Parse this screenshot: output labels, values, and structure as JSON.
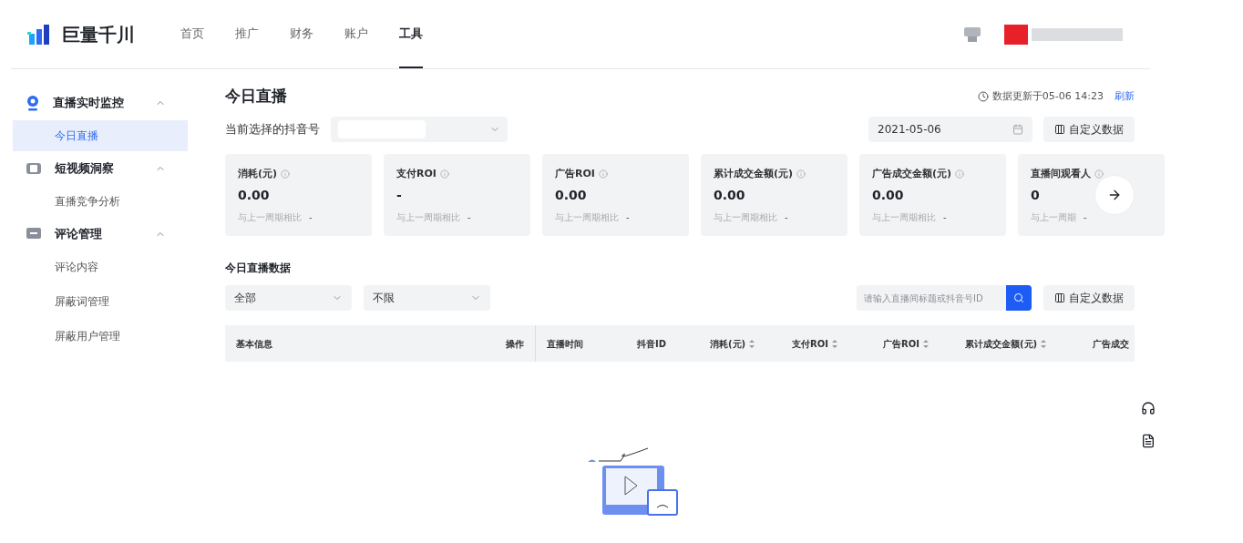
{
  "brand": "巨量千川",
  "nav": [
    {
      "label": "首页",
      "selected": false
    },
    {
      "label": "推广",
      "selected": false
    },
    {
      "label": "财务",
      "selected": false
    },
    {
      "label": "账户",
      "selected": false
    },
    {
      "label": "工具",
      "selected": true
    }
  ],
  "sidebar": [
    {
      "label": "直播实时监控",
      "kind": "live",
      "expanded": true,
      "children": [
        {
          "label": "今日直播",
          "selected": true
        }
      ]
    },
    {
      "label": "短视频洞察",
      "kind": "video",
      "expanded": true,
      "children": [
        {
          "label": "直播竞争分析",
          "selected": false
        }
      ]
    },
    {
      "label": "评论管理",
      "kind": "comment",
      "expanded": true,
      "children": [
        {
          "label": "评论内容",
          "selected": false
        },
        {
          "label": "屏蔽词管理",
          "selected": false
        },
        {
          "label": "屏蔽用户管理",
          "selected": false
        }
      ]
    }
  ],
  "page_title": "今日直播",
  "update_time": "数据更新于05-06 14:23",
  "refresh_link": "刷新",
  "account_label": "当前选择的抖音号",
  "date": "2021-05-06",
  "custom_button": "自定义数据",
  "metrics": [
    {
      "title": "消耗(元)",
      "value": "0.00",
      "compare": "与上一周期相比"
    },
    {
      "title": "支付ROI",
      "value": "-",
      "compare": "与上一周期相比"
    },
    {
      "title": "广告ROI",
      "value": "0.00",
      "compare": "与上一周期相比"
    },
    {
      "title": "累计成交金额(元)",
      "value": "0.00",
      "compare": "与上一周期相比"
    },
    {
      "title": "广告成交金额(元)",
      "value": "0.00",
      "compare": "与上一周期相比"
    },
    {
      "title": "直播间观看人",
      "value": "0",
      "compare": "与上一周期"
    }
  ],
  "compare_value": "-",
  "section_title": "今日直播数据",
  "filters": [
    "全部",
    "不限"
  ],
  "search": {
    "placeholder": "请输入直播间标题或抖音号ID"
  },
  "table_button": "自定义数据",
  "columns": [
    {
      "label": "基本信息",
      "sortable": false
    },
    {
      "label": "操作",
      "sortable": false
    },
    {
      "label": "直播时间",
      "sortable": false
    },
    {
      "label": "抖音ID",
      "sortable": false
    },
    {
      "label": "消耗(元)",
      "sortable": true
    },
    {
      "label": "支付ROI",
      "sortable": true
    },
    {
      "label": "广告ROI",
      "sortable": true
    },
    {
      "label": "累计成交金额(元)",
      "sortable": true
    },
    {
      "label": "广告成交",
      "sortable": false
    }
  ]
}
